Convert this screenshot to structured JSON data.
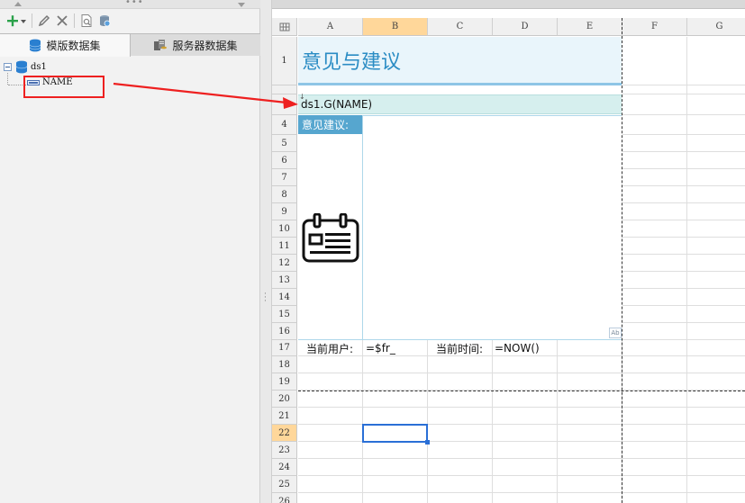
{
  "toolbar": {
    "add_icon": "plus-dropdown-icon",
    "edit_icon": "pencil-icon",
    "delete_icon": "close-icon",
    "preview_icon": "preview-icon",
    "db_icon": "database-settings-icon"
  },
  "tabs": [
    {
      "label": "模版数据集",
      "icon": "database-icon"
    },
    {
      "label": "服务器数据集",
      "icon": "server-icon"
    }
  ],
  "tree": {
    "dataset": "ds1",
    "field": "NAME"
  },
  "sheet": {
    "columns": [
      "A",
      "B",
      "C",
      "D",
      "E",
      "F",
      "G"
    ],
    "selected_column": "B",
    "rows": [
      "1",
      "",
      "",
      "4",
      "5",
      "6",
      "7",
      "8",
      "9",
      "10",
      "11",
      "12",
      "13",
      "14",
      "15",
      "16",
      "17",
      "18",
      "19",
      "20",
      "21",
      "22",
      "23",
      "24",
      "25",
      "26"
    ],
    "selected_row": "22",
    "cells": {
      "title": "意见与建议",
      "ds_expr": "ds1.G(NAME)",
      "advice_label": "意见建议:",
      "user_label": "当前用户:",
      "user_value": "=$fr_",
      "time_label": "当前时间:",
      "time_value": "=NOW()"
    }
  },
  "colors": {
    "title_text": "#2a8cc4",
    "title_bg": "#e9f5fb",
    "ds_bg": "#d6efee",
    "advice_bg": "#56a6cf",
    "highlight": "#ee2020",
    "selection": "#2a6fd6"
  }
}
